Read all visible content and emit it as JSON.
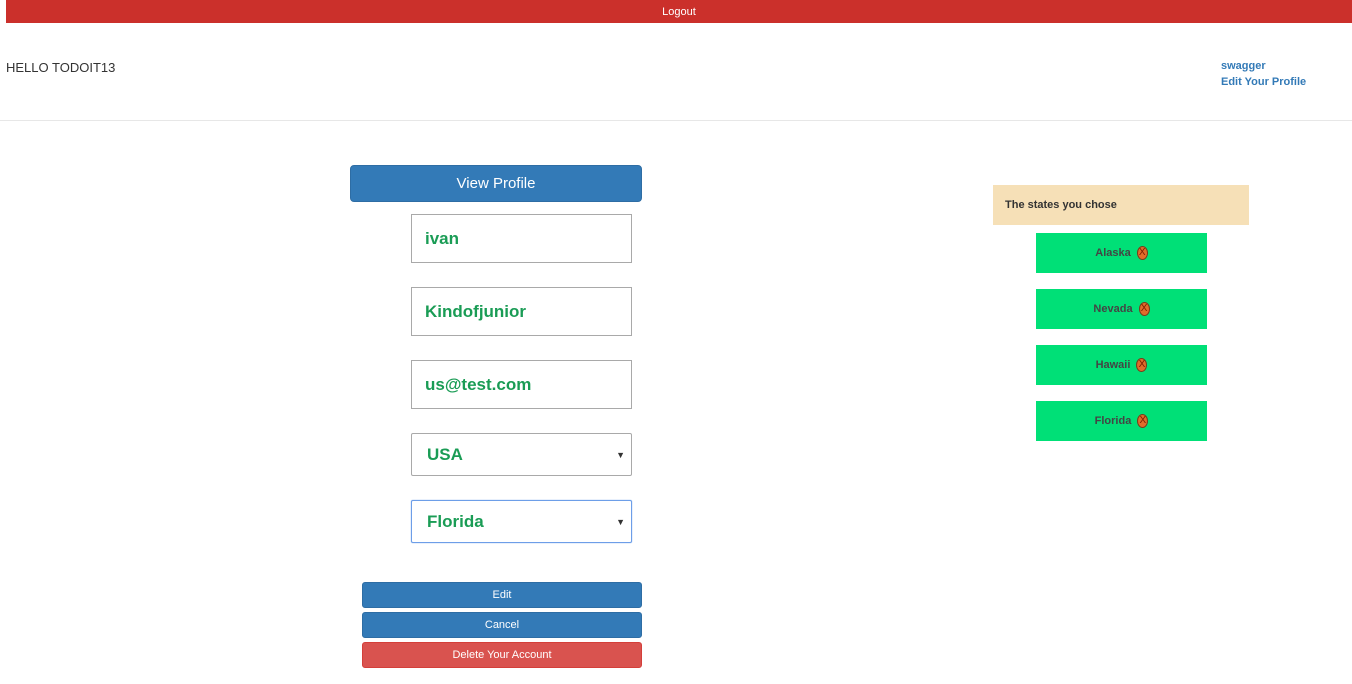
{
  "header": {
    "logout_label": "Logout",
    "greeting": "HELLO TODOIT13",
    "links": {
      "swagger": "swagger",
      "edit_profile": "Edit Your Profile"
    }
  },
  "profile": {
    "view_profile_label": "View Profile",
    "first_name": "ivan",
    "last_name": "Kindofjunior",
    "email": "us@test.com",
    "country": "USA",
    "state": "Florida",
    "edit_label": "Edit",
    "cancel_label": "Cancel",
    "delete_label": "Delete Your Account"
  },
  "states_panel": {
    "header": "The states you chose",
    "items": [
      {
        "label": "Alaska"
      },
      {
        "label": "Nevada"
      },
      {
        "label": "Hawaii"
      },
      {
        "label": "Florida"
      }
    ],
    "remove_glyph": "X"
  },
  "colors": {
    "logout_bar": "#cb302b",
    "primary_button": "#337ab7",
    "danger_button": "#d9534f",
    "field_text": "#1a9c55",
    "state_item": "#00e077",
    "states_header": "#f6e0b7"
  }
}
